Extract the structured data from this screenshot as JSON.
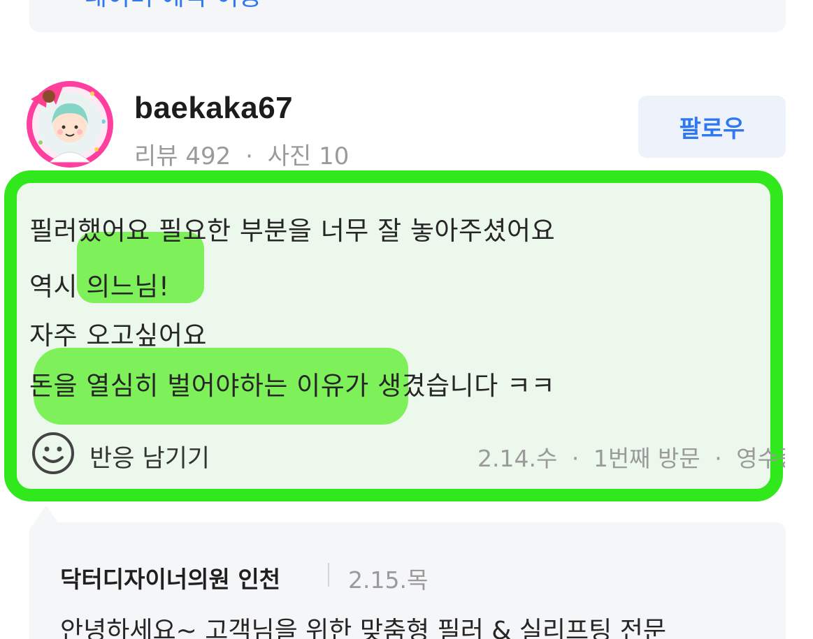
{
  "top_card": {
    "text": "네이버 예약 이용"
  },
  "reviewer": {
    "username": "baekaka67",
    "review_count_label": "리뷰 492",
    "photo_count_label": "사진 10",
    "separator": "·"
  },
  "follow_button": {
    "label": "팔로우"
  },
  "review": {
    "lines": [
      "필러했어요 필요한 부분을 너무 잘 놓아주셨어요",
      "역시 의느님!",
      "자주 오고싶어요",
      "돈을 열심히 벌어야하는 이유가 생겼습니다 ㅋㅋ"
    ],
    "highlight_color": "#31e81d"
  },
  "reaction": {
    "label": "반응 남기기",
    "icon": "smiley-icon"
  },
  "visit_info": {
    "date": "2.14.수",
    "visit": "1번째 방문",
    "receipt": "영수증",
    "separator": "·"
  },
  "reply": {
    "name": "닥터디자이너의원 인천",
    "date": "2.15.목",
    "text": "안녕하세요~ 고객님을 위한 맞춤형 필러 & 실리프팅 전문"
  },
  "colors": {
    "accent_blue": "#2f78f0",
    "muted_gray": "#9a9a9a",
    "card_bg": "#f5f6f8"
  }
}
